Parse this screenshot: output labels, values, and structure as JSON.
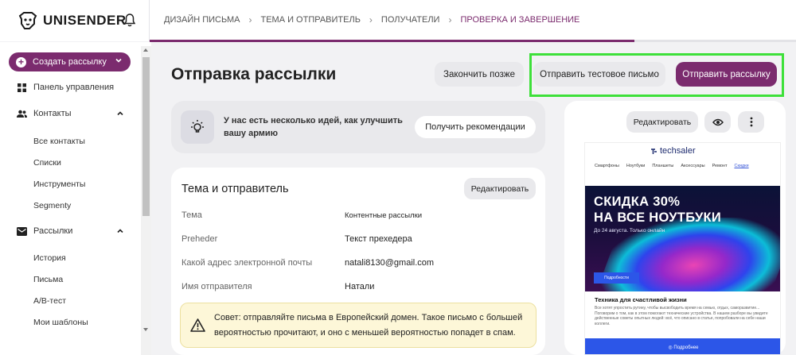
{
  "header": {
    "logo_text": "UNISENDER",
    "breadcrumbs": [
      {
        "label": "ДИЗАЙН ПИСЬМА"
      },
      {
        "label": "ТЕМА И ОТПРАВИТЕЛЬ"
      },
      {
        "label": "ПОЛУЧАТЕЛИ"
      },
      {
        "label": "ПРОВЕРКА И ЗАВЕРШЕНИЕ"
      }
    ],
    "progress_fraction": 0.75
  },
  "sidebar": {
    "create_label": "Создать рассылку",
    "dashboard": "Панель управления",
    "contacts": "Контакты",
    "contacts_items": [
      "Все контакты",
      "Списки",
      "Инструменты",
      "Segmenty"
    ],
    "mailings": "Рассылки",
    "mailings_items": [
      "История",
      "Письма",
      "A/B-тест",
      "Мои шаблоны"
    ]
  },
  "main": {
    "title": "Отправка рассылки",
    "finish_later": "Закончить позже",
    "send_test": "Отправить тестовое письмо",
    "send": "Отправить рассылку"
  },
  "ideas": {
    "text": "У нас есть несколько идей, как улучшить вашу армию",
    "button": "Получить рекомендации"
  },
  "subject_card": {
    "title": "Тема и отправитель",
    "edit": "Редактировать",
    "fields": [
      {
        "label": "Тема",
        "value": "Контентные рассылки"
      },
      {
        "label": "Preheder",
        "value": "Текст прехедера"
      },
      {
        "label": "Какой адрес электронной почты",
        "value": "natali8130@gmail.com"
      },
      {
        "label": "Имя отправителя",
        "value": "Натали"
      }
    ],
    "tip": "Совет: отправляйте письма в Европейский домен. Такое письмо с большей вероятностью прочитают, и оно с меньшей вероятностью попадет в спам."
  },
  "preview": {
    "edit": "Редактировать",
    "brand": "techsaler",
    "menu": [
      "Смартфоны",
      "Ноутбуки",
      "Планшеты",
      "Аксессуары",
      "Ремонт",
      "Скидки"
    ],
    "banner_title": "СКИДКА 30%\nНА ВСЕ НОУТБУКИ",
    "banner_sub": "До 24 августа. Только онлайн",
    "banner_button": "Подробности",
    "article_title": "Техника для счастливой жизни",
    "article_body": "Все хотят упростить рутину, чтобы высвободить время на семью, отдых, саморазвитие... Поговорим о том, как в этом помогают технические устройства. В нашем разборе вы увидите действенные советы опытных людей: всё, что описано в статье, попробовали на себе наши коллеги.",
    "cta": "◎ Подробнее"
  },
  "colors": {
    "accent": "#7b2b6e",
    "highlight": "#3ee03a",
    "tip_bg": "#fdf7d8",
    "email_blue": "#2c56e8"
  }
}
